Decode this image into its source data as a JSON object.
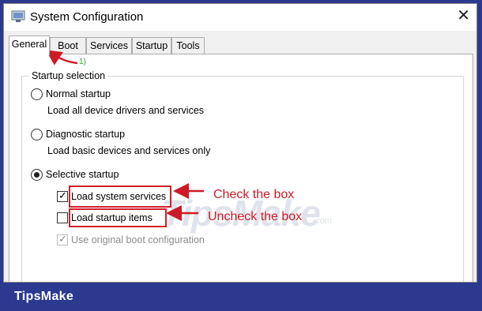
{
  "window": {
    "title": "System Configuration",
    "close_glyph": "✕"
  },
  "tabs": [
    {
      "label": "General",
      "active": true
    },
    {
      "label": "Boot",
      "active": false
    },
    {
      "label": "Services",
      "active": false
    },
    {
      "label": "Startup",
      "active": false
    },
    {
      "label": "Tools",
      "active": false
    }
  ],
  "startup_selection": {
    "legend": "Startup selection",
    "options": [
      {
        "label": "Normal startup",
        "description": "Load all device drivers and services",
        "selected": false
      },
      {
        "label": "Diagnostic startup",
        "description": "Load basic devices and services only",
        "selected": false
      },
      {
        "label": "Selective startup",
        "description": "",
        "selected": true
      }
    ],
    "checkboxes": [
      {
        "label": "Load system services",
        "checked": true,
        "enabled": true
      },
      {
        "label": "Load startup items",
        "checked": false,
        "enabled": true
      },
      {
        "label": "Use original boot configuration",
        "checked": true,
        "enabled": false
      }
    ]
  },
  "annotations": {
    "step": "1)",
    "check": "Check the box",
    "uncheck": "Uncheck the box",
    "color": "#cc1b26"
  },
  "watermark": {
    "text": "TipsMake",
    "suffix": ".com"
  },
  "footer": {
    "brand": "TipsMake",
    "background": "#2b3a8f"
  },
  "icons": {
    "app": "system-config-icon",
    "close": "close-icon",
    "checkmark": "checkmark-icon"
  }
}
